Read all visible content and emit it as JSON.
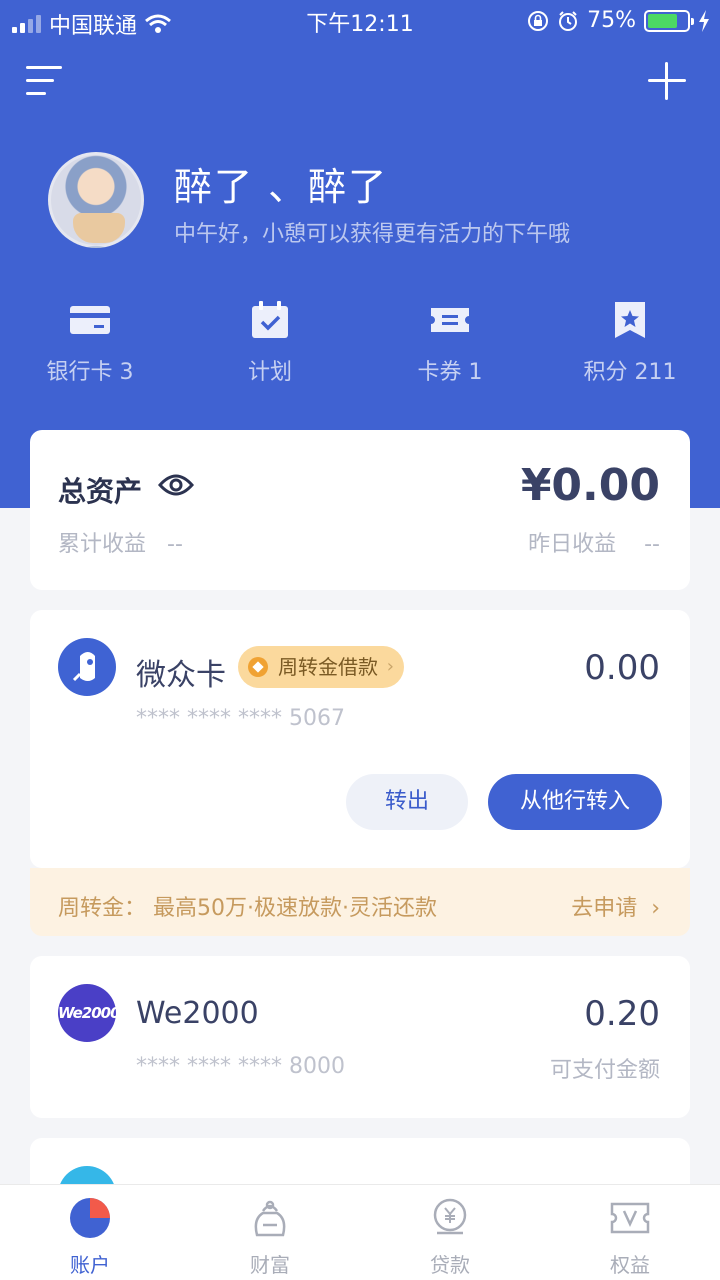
{
  "status_bar": {
    "carrier": "中国联通",
    "time": "下午12:11",
    "battery": "75%"
  },
  "profile": {
    "name": "醉了 、醉了",
    "greeting": "中午好，小憩可以获得更有活力的下午哦"
  },
  "quick_links": [
    {
      "label": "银行卡 3",
      "icon": "bank-card-icon"
    },
    {
      "label": "计划",
      "icon": "calendar-check-icon"
    },
    {
      "label": "卡券 1",
      "icon": "ticket-icon"
    },
    {
      "label": "积分 211",
      "icon": "bookmark-star-icon"
    }
  ],
  "assets": {
    "title": "总资产",
    "amount": "¥0.00",
    "cumulative_label": "累计收益",
    "cumulative_value": "--",
    "yesterday_label": "昨日收益",
    "yesterday_value": "--"
  },
  "weizhong_card": {
    "name": "微众卡",
    "tag": "周转金借款",
    "amount": "0.00",
    "number": "**** **** **** 5067",
    "transfer_out": "转出",
    "transfer_in": "从他行转入"
  },
  "promo": {
    "text": "周转金：  最高50万·极速放款·灵活还款",
    "link": "去申请"
  },
  "we2000_card": {
    "logo": "We2000",
    "name": "We2000",
    "amount": "0.20",
    "number": "**** **** **** 8000",
    "sub_label": "可支付金额"
  },
  "tabs": [
    {
      "label": "账户",
      "icon": "pie-chart-icon",
      "active": true
    },
    {
      "label": "财富",
      "icon": "money-bag-icon",
      "active": false
    },
    {
      "label": "贷款",
      "icon": "yen-coin-icon",
      "active": false
    },
    {
      "label": "权益",
      "icon": "vip-ticket-icon",
      "active": false
    }
  ],
  "colors": {
    "brand_blue": "#4062d2",
    "promo_bg": "#fdf2e2",
    "tag_bg": "#fbd99d"
  }
}
